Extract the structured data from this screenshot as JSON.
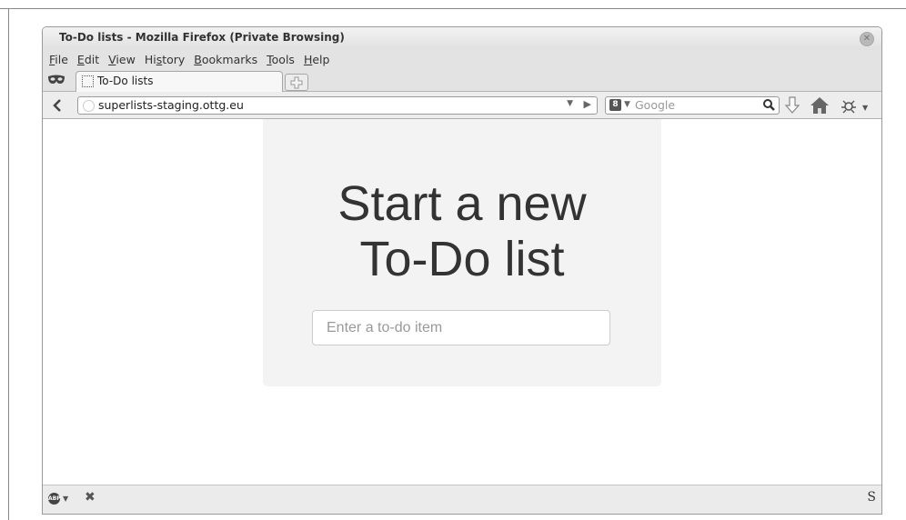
{
  "window": {
    "title": "To-Do lists - Mozilla Firefox (Private Browsing)"
  },
  "menubar": {
    "items": [
      {
        "label": "File",
        "mnemonic": "F",
        "rest": "ile"
      },
      {
        "label": "Edit",
        "mnemonic": "E",
        "rest": "dit"
      },
      {
        "label": "View",
        "mnemonic": "V",
        "rest": "iew"
      },
      {
        "label": "History",
        "pre": "Hi",
        "mnemonic": "s",
        "rest": "tory"
      },
      {
        "label": "Bookmarks",
        "mnemonic": "B",
        "rest": "ookmarks"
      },
      {
        "label": "Tools",
        "mnemonic": "T",
        "rest": "ools"
      },
      {
        "label": "Help",
        "mnemonic": "H",
        "rest": "elp"
      }
    ]
  },
  "tabs": [
    {
      "label": "To-Do lists",
      "active": true
    }
  ],
  "navbar": {
    "url": "superlists-staging.ottg.eu",
    "search_placeholder": "Google",
    "search_engine_icon": "google-plus-icon"
  },
  "page": {
    "headline_line1": "Start a new",
    "headline_line2": "To-Do list",
    "input_placeholder": "Enter a to-do item"
  },
  "statusbar": {
    "left_icon": "adblock-plus-icon",
    "right_icon": "sync-icon",
    "right_label": "S"
  },
  "icons": {
    "private_browsing": "private-browsing-mask-icon",
    "back": "back-arrow-icon",
    "download": "download-arrow-icon",
    "home": "home-icon",
    "addon": "addon-bug-icon"
  },
  "colors": {
    "jumbotron_bg": "#f3f3f3",
    "headline_text": "#333333",
    "chrome_bg": "#e3e3e3"
  }
}
